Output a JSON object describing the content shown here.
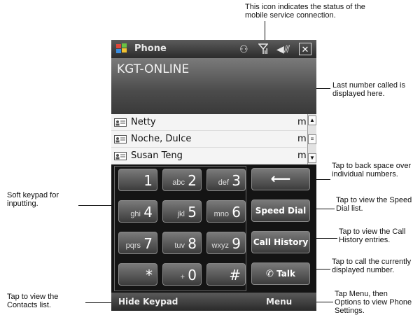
{
  "annotations": {
    "status_icon": "This icon indicates the status of the mobile service connection.",
    "last_number": "Last number called is displayed here.",
    "soft_keypad": "Soft keypad for inputting.",
    "backspace": "Tap to back space over individual numbers.",
    "speed_dial": "Tap to view the Speed Dial list.",
    "call_history": "Tap to view the Call History entries.",
    "talk": "Tap to call the currently displayed number.",
    "contacts": "Tap to view the Contacts list.",
    "menu": "Tap Menu, then Options to view Phone Settings."
  },
  "titlebar": {
    "title": "Phone",
    "icons": [
      "windows-logo-icon",
      "connectivity-icon",
      "signal-icon",
      "speaker-icon",
      "close-icon"
    ]
  },
  "display": {
    "network": "KGT-ONLINE"
  },
  "contacts": [
    {
      "name": "Netty",
      "type": "m"
    },
    {
      "name": "Noche, Dulce",
      "type": "m"
    },
    {
      "name": "Susan Teng",
      "type": "m"
    }
  ],
  "keypad": [
    {
      "letters": "",
      "digit": "1"
    },
    {
      "letters": "abc",
      "digit": "2"
    },
    {
      "letters": "def",
      "digit": "3"
    },
    {
      "letters": "ghi",
      "digit": "4"
    },
    {
      "letters": "jkl",
      "digit": "5"
    },
    {
      "letters": "mno",
      "digit": "6"
    },
    {
      "letters": "pqrs",
      "digit": "7"
    },
    {
      "letters": "tuv",
      "digit": "8"
    },
    {
      "letters": "wxyz",
      "digit": "9"
    },
    {
      "letters": "",
      "digit": "*"
    },
    {
      "letters": "+",
      "digit": "0"
    },
    {
      "letters": "",
      "digit": "#"
    }
  ],
  "side_buttons": {
    "backspace": "⟵",
    "speed_dial": "Speed Dial",
    "call_history": "Call History",
    "talk": "Talk"
  },
  "softkeys": {
    "left": "Hide Keypad",
    "right": "Menu"
  },
  "colors": {
    "titlebar": "#3a3a3a",
    "contacts_bg": "#f4f4f4",
    "keypad_bg": "#141414"
  }
}
